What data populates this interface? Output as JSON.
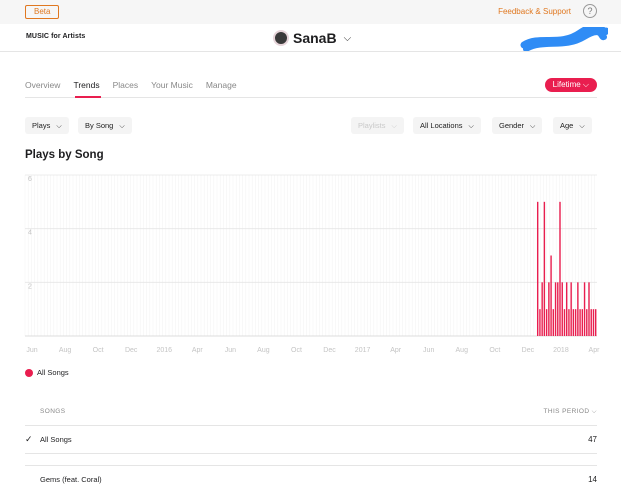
{
  "topbar": {
    "beta_label": "Beta",
    "feedback_label": "Feedback & Support",
    "help_glyph": "?"
  },
  "header": {
    "brand_name": "MUSIC for Artists",
    "artist_name": "SanaB"
  },
  "tabs": [
    {
      "label": "Overview",
      "active": false
    },
    {
      "label": "Trends",
      "active": true
    },
    {
      "label": "Places",
      "active": false
    },
    {
      "label": "Your Music",
      "active": false
    },
    {
      "label": "Manage",
      "active": false
    }
  ],
  "period_button": "Lifetime",
  "filters": {
    "metric": "Plays",
    "grouping": "By Song",
    "playlists": "Playlists",
    "location": "All Locations",
    "gender": "Gender",
    "age": "Age"
  },
  "section_title": "Plays by Song",
  "chart_data": {
    "type": "bar",
    "ylim": [
      0,
      6
    ],
    "yticks": [
      "2",
      "4",
      "6"
    ],
    "x_tick_labels": [
      "Jun",
      "Aug",
      "Oct",
      "Dec",
      "2016",
      "Apr",
      "Jun",
      "Aug",
      "Oct",
      "Dec",
      "2017",
      "Apr",
      "Jun",
      "Aug",
      "Oct",
      "Dec",
      "2018",
      "Apr"
    ],
    "series": [
      {
        "name": "All Songs",
        "color": "#e91e4f",
        "values": [
          5,
          1,
          2,
          5,
          1,
          2,
          3,
          1,
          2,
          2,
          5,
          2,
          1,
          2,
          1,
          2,
          1,
          1,
          2,
          1,
          1,
          2,
          1,
          2,
          1,
          1,
          1
        ]
      }
    ],
    "legend": [
      "All Songs"
    ]
  },
  "table": {
    "col_song": "SONGS",
    "col_period": "THIS PERIOD",
    "rows": [
      {
        "name": "All Songs",
        "value": "47",
        "checked": true
      },
      {
        "name": "Gems (feat. Coral)",
        "value": "14",
        "checked": false
      }
    ]
  }
}
